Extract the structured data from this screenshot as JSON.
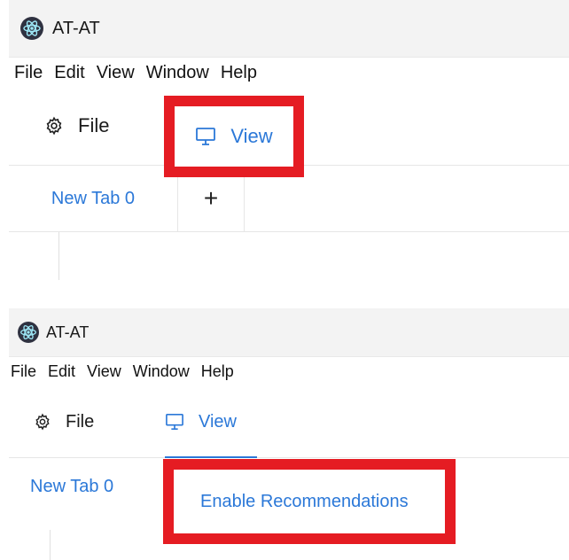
{
  "window": {
    "title": "AT-AT"
  },
  "menubar": {
    "items": [
      "File",
      "Edit",
      "View",
      "Window",
      "Help"
    ]
  },
  "toolbar": {
    "file_label": "File",
    "view_label": "View"
  },
  "tabs": {
    "active_label": "New Tab 0",
    "add_label": "+"
  },
  "dropdown": {
    "item": "Enable Recommendations"
  },
  "colors": {
    "accent": "#2b78d8",
    "highlight": "#e51c23"
  }
}
